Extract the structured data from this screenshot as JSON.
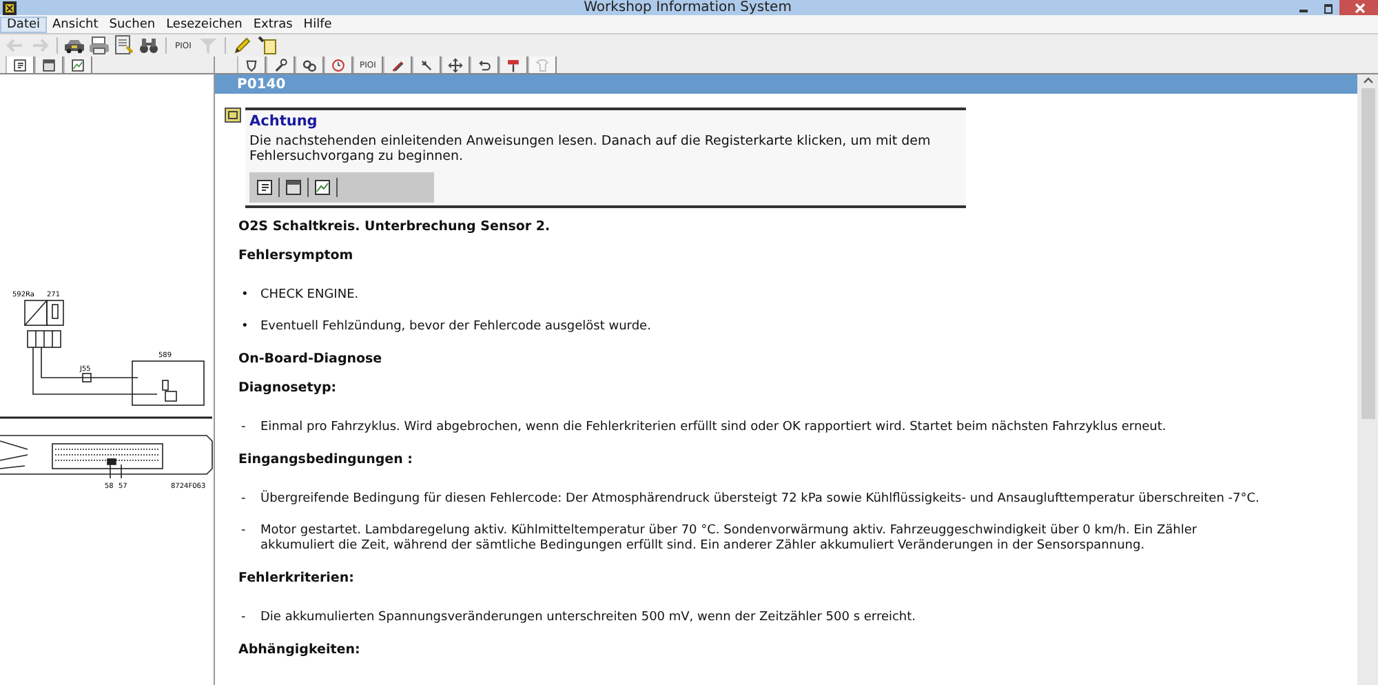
{
  "window": {
    "title": "Workshop Information System"
  },
  "menu": [
    {
      "label": "Datei",
      "selected": true
    },
    {
      "label": "Ansicht",
      "selected": false
    },
    {
      "label": "Suchen",
      "selected": false
    },
    {
      "label": "Lesezeichen",
      "selected": false
    },
    {
      "label": "Extras",
      "selected": false
    },
    {
      "label": "Hilfe",
      "selected": false
    }
  ],
  "toolbar": [
    {
      "kind": "icon",
      "disabled": true
    },
    {
      "kind": "icon",
      "disabled": true
    },
    {
      "kind": "separator"
    },
    {
      "kind": "icon",
      "disabled": false
    },
    {
      "kind": "icon",
      "disabled": false
    },
    {
      "kind": "icon",
      "disabled": false
    },
    {
      "kind": "icon",
      "disabled": false
    },
    {
      "kind": "separator"
    },
    {
      "kind": "text",
      "label": "PIOI"
    },
    {
      "kind": "icon",
      "disabled": true
    },
    {
      "kind": "separator"
    },
    {
      "kind": "icon",
      "disabled": false
    },
    {
      "kind": "icon",
      "disabled": false
    }
  ],
  "left_tabs": [
    {
      "selected": true
    },
    {
      "selected": false
    },
    {
      "selected": false
    }
  ],
  "right_tabs": [
    {
      "kind": "icon",
      "disabled": false
    },
    {
      "kind": "icon",
      "disabled": false
    },
    {
      "kind": "icon",
      "disabled": false
    },
    {
      "kind": "icon",
      "disabled": false
    },
    {
      "kind": "text",
      "label": "PIOI"
    },
    {
      "kind": "icon",
      "disabled": false
    },
    {
      "kind": "icon",
      "disabled": false
    },
    {
      "kind": "icon",
      "disabled": false
    },
    {
      "kind": "icon",
      "disabled": false
    },
    {
      "kind": "icon",
      "disabled": false
    },
    {
      "kind": "icon",
      "disabled": true
    }
  ],
  "diagram": {
    "labels": [
      "592Ra",
      "271",
      "J55",
      "589",
      "58",
      "57",
      "8724F063"
    ]
  },
  "document": {
    "code": "P0140",
    "notice": {
      "title": "Achtung",
      "text": "Die nachstehenden einleitenden Anweisungen lesen. Danach auf die Registerkarte klicken, um mit dem Fehlersuchvorgang zu beginnen."
    },
    "blocks": [
      {
        "kind": "title",
        "text": "O2S Schaltkreis. Unterbrechung Sensor 2."
      },
      {
        "kind": "heading",
        "text": "Fehlersymptom"
      },
      {
        "kind": "list",
        "marker": "•",
        "items": [
          "CHECK ENGINE.",
          "Eventuell Fehlzündung, bevor der Fehlercode ausgelöst wurde."
        ]
      },
      {
        "kind": "heading",
        "text": "On-Board-Diagnose"
      },
      {
        "kind": "heading",
        "text": "Diagnosetyp:"
      },
      {
        "kind": "list",
        "marker": "-",
        "items": [
          "Einmal pro Fahrzyklus. Wird abgebrochen, wenn die Fehlerkriterien erfüllt sind oder OK rapportiert wird. Startet beim nächsten Fahrzyklus erneut."
        ]
      },
      {
        "kind": "heading",
        "text": "Eingangsbedingungen :"
      },
      {
        "kind": "list",
        "marker": "-",
        "items": [
          "Übergreifende Bedingung für diesen Fehlercode: Der Atmosphärendruck übersteigt 72 kPa sowie Kühlflüssigkeits- und Ansauglufttemperatur überschreiten -7°C.",
          "Motor gestartet. Lambdaregelung aktiv. Kühlmitteltemperatur über 70 °C. Sondenvorwärmung aktiv. Fahrzeuggeschwindigkeit über 0 km/h. Ein Zähler akkumuliert die Zeit, während der sämtliche Bedingungen erfüllt sind. Ein anderer Zähler akkumuliert Veränderungen in der Sensorspannung."
        ]
      },
      {
        "kind": "heading",
        "text": "Fehlerkriterien:"
      },
      {
        "kind": "list",
        "marker": "-",
        "items": [
          "Die akkumulierten Spannungsveränderungen unterschreiten 500 mV, wenn der Zeitzähler 500 s erreicht."
        ]
      },
      {
        "kind": "heading",
        "text": "Abhängigkeiten:"
      }
    ]
  }
}
